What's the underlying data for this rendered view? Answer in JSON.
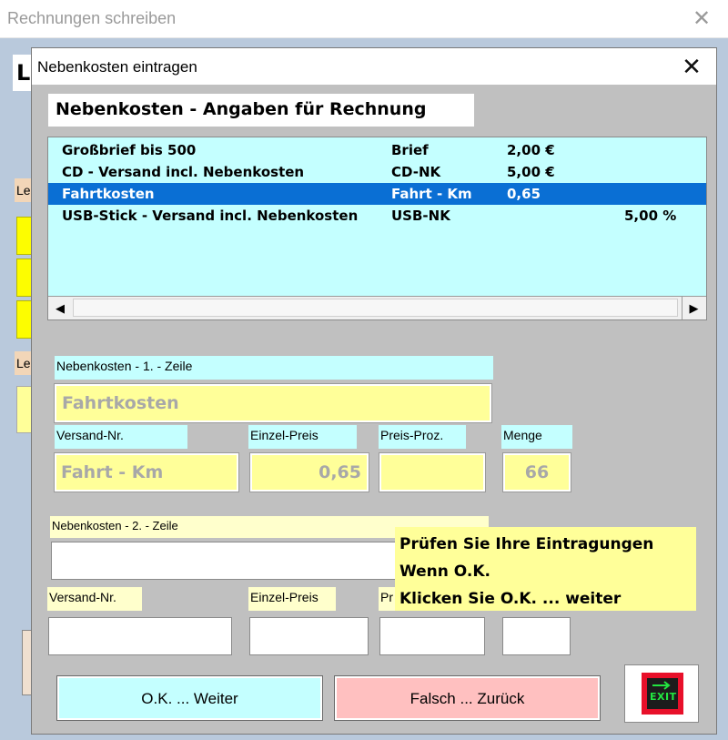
{
  "background_window": {
    "title": "Rechnungen schreiben",
    "close_glyph": "✕",
    "frag_1": "L",
    "frag_2": "Le",
    "frag_3": "Le"
  },
  "dialog": {
    "title": "Nebenkosten eintragen",
    "close_glyph": "✕",
    "header": "Nebenkosten  -  Angaben für Rechnung"
  },
  "list": {
    "rows": [
      {
        "name": "Großbrief bis 500",
        "code": "Brief",
        "price": "2,00 €",
        "percent": ""
      },
      {
        "name": "CD - Versand incl. Nebenkosten",
        "code": "CD-NK",
        "price": "5,00 €",
        "percent": ""
      },
      {
        "name": "Fahrtkosten",
        "code": "Fahrt - Km",
        "price": "0,65",
        "percent": ""
      },
      {
        "name": "USB-Stick - Versand incl. Nebenkosten",
        "code": "USB-NK",
        "price": "",
        "percent": "5,00 %"
      }
    ],
    "selected_index": 2,
    "scroll_left_icon": "◀",
    "scroll_right_icon": "▶"
  },
  "line1": {
    "section_label": "Nebenkosten - 1.   -  Zeile",
    "description_value": "Fahrtkosten",
    "versand_label": "Versand-Nr.",
    "versand_value": "Fahrt - Km",
    "einzel_label": "Einzel-Preis",
    "einzel_value": "0,65",
    "proz_label": "Preis-Proz.",
    "proz_value": "",
    "menge_label": "Menge",
    "menge_value": "66"
  },
  "line2": {
    "section_label": "Nebenkosten - 2.   -  Zeile",
    "description_value": "",
    "versand_label": "Versand-Nr.",
    "versand_value": "",
    "einzel_label": "Einzel-Preis",
    "einzel_value": "",
    "proz_label": "Pr",
    "proz_value": "",
    "menge_value": ""
  },
  "message": {
    "line1": "Prüfen Sie Ihre Eintragungen",
    "line2": "Wenn  O.K.",
    "line3": "Klicken Sie O.K. ... weiter"
  },
  "buttons": {
    "ok": "O.K. ... Weiter",
    "back": "Falsch  ...  Zurück",
    "exit_icon_text": "EXIT"
  },
  "colors": {
    "list_bg": "#c4ffff",
    "selection": "#0a6fd4",
    "field_yellow": "#ffff99",
    "ok_button": "#c4ffff",
    "back_button": "#ffc0c0",
    "exit_red": "#e8102a",
    "exit_green": "#22e640"
  }
}
